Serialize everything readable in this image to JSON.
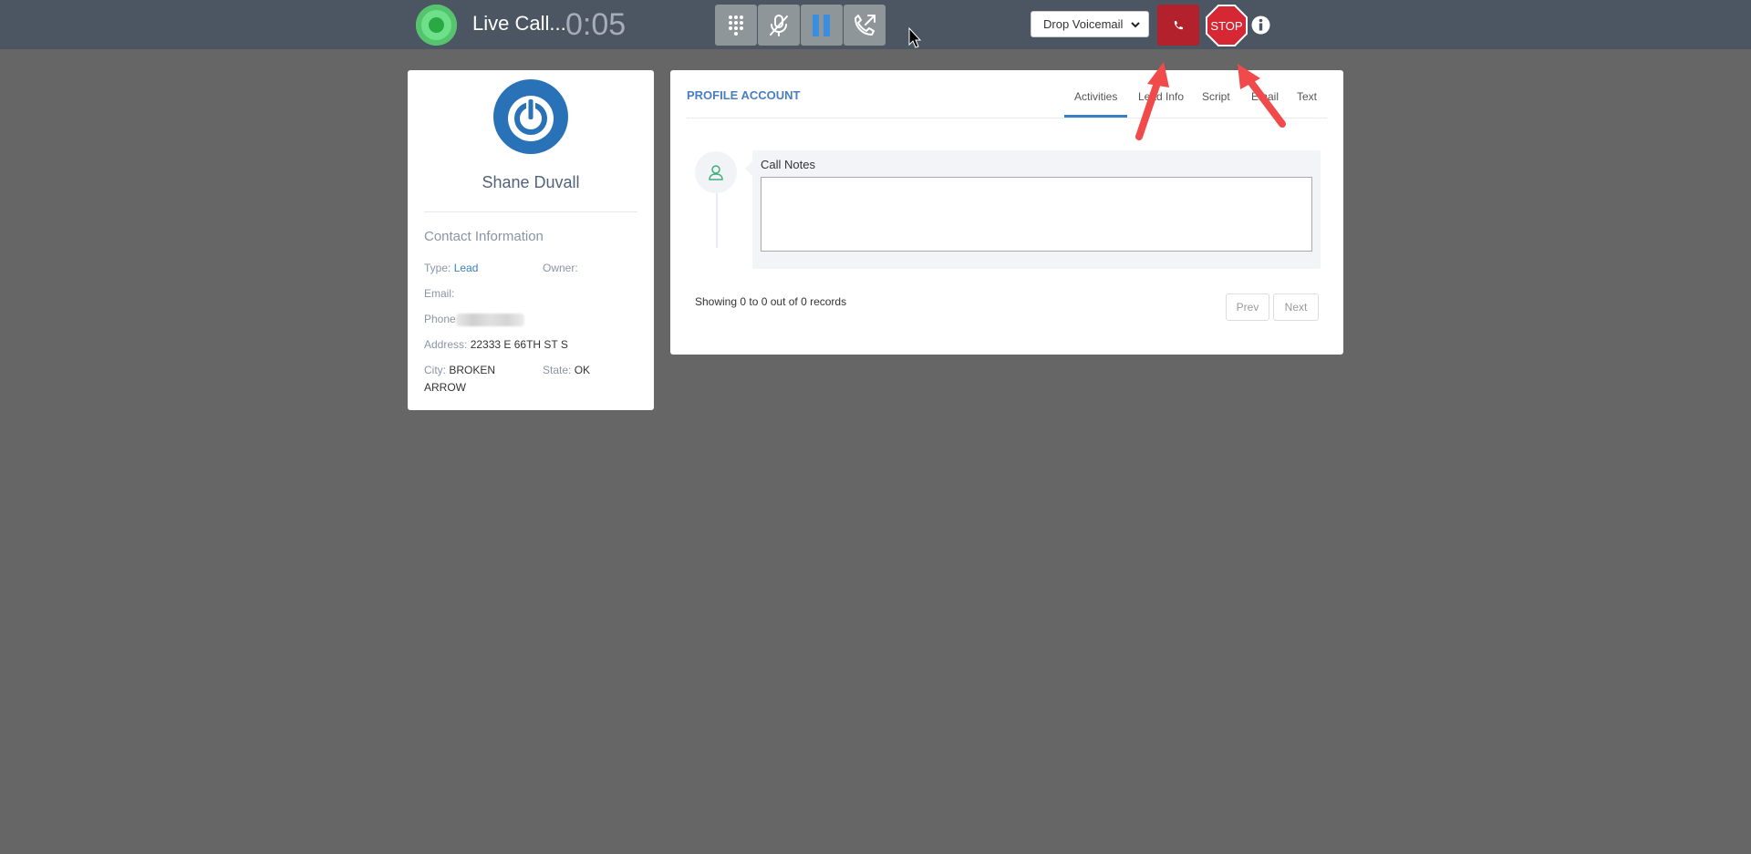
{
  "call": {
    "status_label": "Live Call...",
    "timer": "0:05",
    "controls": [
      {
        "name": "dialpad",
        "icon": "dialpad-icon"
      },
      {
        "name": "mute",
        "icon": "mic-off-icon"
      },
      {
        "name": "hold",
        "icon": "pause-icon"
      },
      {
        "name": "transfer",
        "icon": "phone-transfer-icon"
      }
    ],
    "voicemail_selected": "Drop Voicemail",
    "hangup_icon": "phone-icon",
    "stop_label": "STOP",
    "info_icon": "info-icon"
  },
  "contact": {
    "name": "Shane Duvall",
    "section_heading": "Contact Information",
    "type_label": "Type:",
    "type_value": "Lead",
    "owner_label": "Owner:",
    "owner_value": "",
    "email_label": "Email:",
    "email_value": "",
    "phone_label": "Phone",
    "address_label": "Address:",
    "address_value": "22333 E 66TH ST S",
    "city_label": "City:",
    "city_value": "BROKEN ARROW",
    "state_label": "State:",
    "state_value": "OK"
  },
  "profile": {
    "title": "PROFILE ACCOUNT",
    "tabs": [
      "Activities",
      "Lead Info",
      "Script",
      "Email",
      "Text"
    ],
    "active_tab": "Activities",
    "notes_label": "Call Notes",
    "notes_value": "",
    "records_text": "Showing 0 to 0 out of 0 records",
    "prev_label": "Prev",
    "next_label": "Next"
  },
  "colors": {
    "topbar": "#4c5562",
    "background": "#666666",
    "accent": "#3a7fc1",
    "hangup": "#b3222c",
    "live": "#56c46e"
  }
}
